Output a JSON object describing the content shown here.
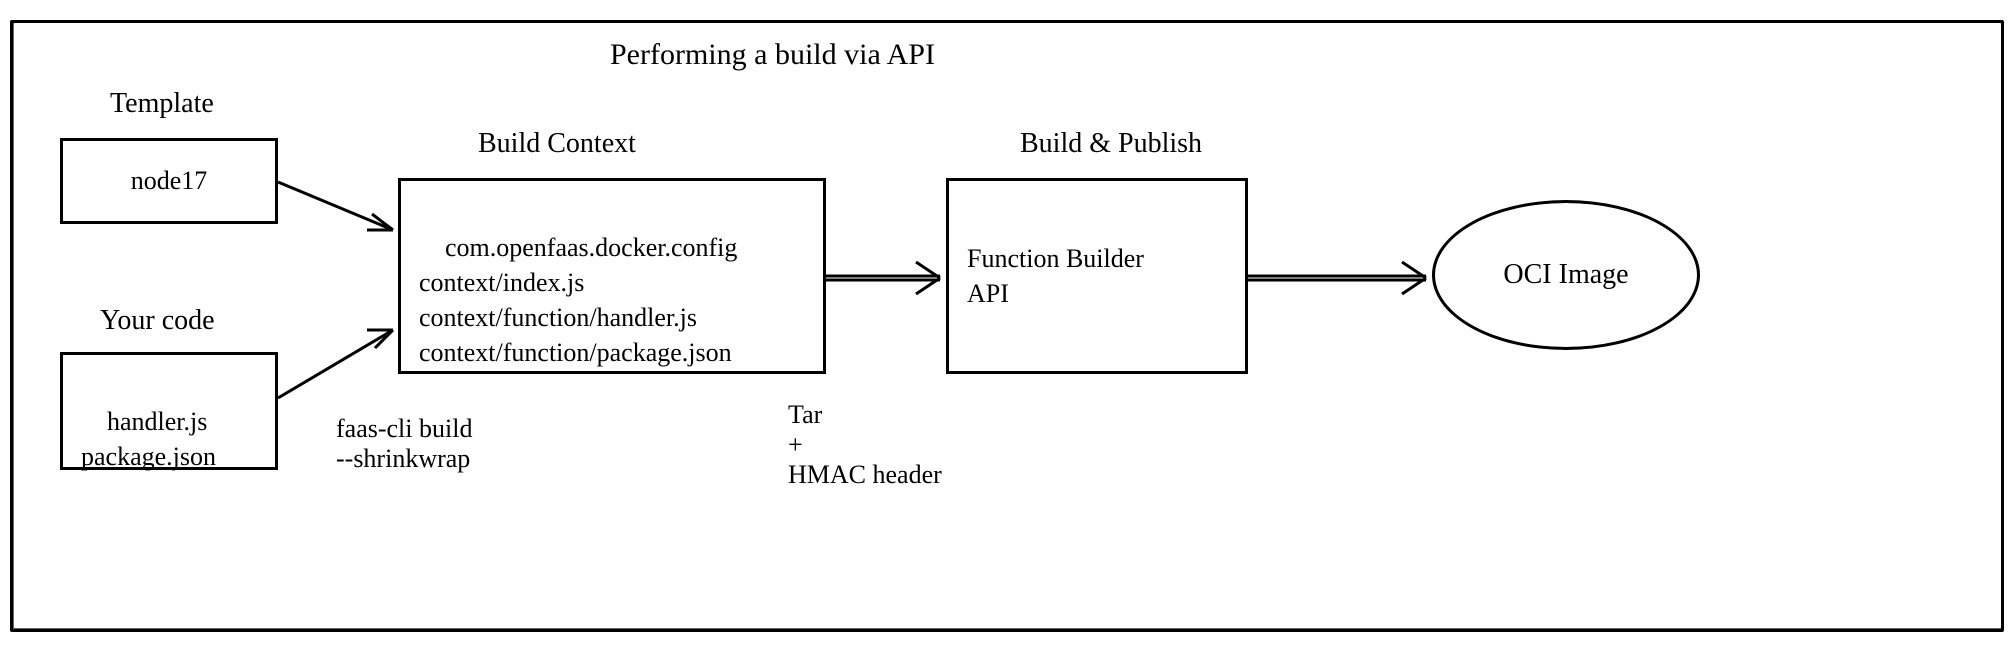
{
  "title": "Performing a build via API",
  "labels": {
    "template": "Template",
    "your_code": "Your code",
    "build_context": "Build Context",
    "build_publish": "Build & Publish"
  },
  "template_box": "node17",
  "your_code_box": "handler.js\npackage.json",
  "build_context_box": "com.openfaas.docker.config\ncontext/index.js\ncontext/function/handler.js\ncontext/function/package.json",
  "builder_box": "Function Builder\nAPI",
  "oci_ellipse": "OCI Image",
  "arrow_notes": {
    "shrinkwrap": "faas-cli build\n--shrinkwrap",
    "tar_hmac": "Tar\n+\nHMAC header"
  }
}
